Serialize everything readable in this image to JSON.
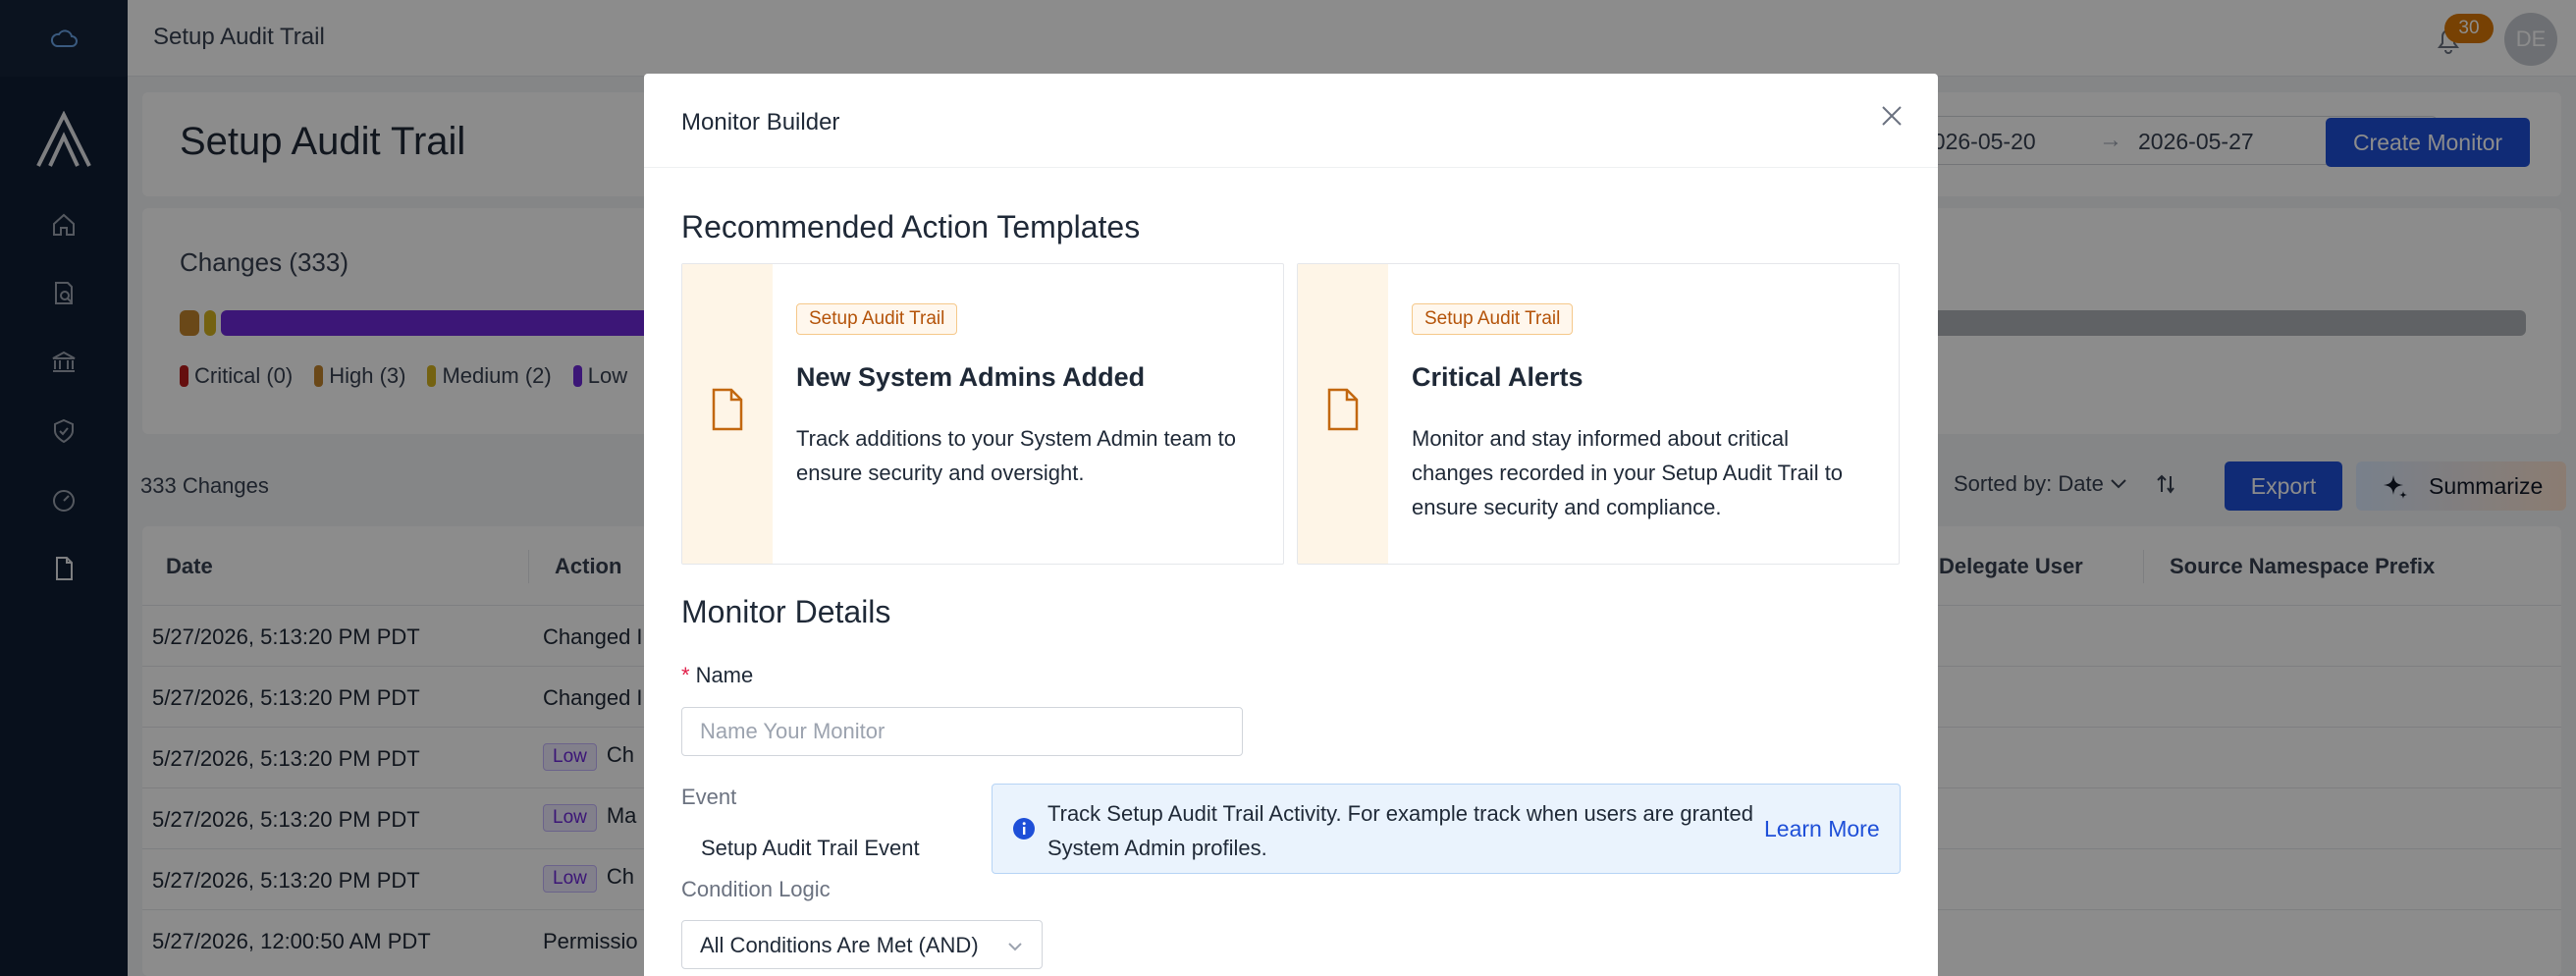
{
  "topbar": {
    "title": "Setup Audit Trail",
    "notification_count": "30",
    "avatar_initials": "DE"
  },
  "rail": {
    "icons": [
      "cloud-icon",
      "app-logo",
      "home-icon",
      "search-document-icon",
      "bank-icon",
      "shield-check-icon",
      "gauge-icon",
      "document-icon"
    ]
  },
  "page": {
    "title": "Setup Audit Trail",
    "date_from": "2026-05-20",
    "date_to": "2026-05-27",
    "date_arrow": "→",
    "create_monitor_label": "Create Monitor",
    "changes_title": "Changes (333)",
    "severity": {
      "critical": {
        "label": "Critical (0)",
        "color": "#b45309"
      },
      "high": {
        "label": "High (3)",
        "color": "#c2832c"
      },
      "medium": {
        "label": "Medium (2)",
        "color": "#d4b21f"
      },
      "low": {
        "label": "Low",
        "color": "#6d28d9"
      }
    },
    "changes_count": "333 Changes",
    "sorted_label": "Sorted by: Date",
    "export_label": "Export",
    "summarize_label": "Summarize",
    "table": {
      "headers": {
        "date": "Date",
        "action": "Action",
        "delegate_user": "Delegate User",
        "source_namespace": "Source Namespace Prefix"
      },
      "rows": [
        {
          "date": "5/27/2026, 5:13:20 PM PDT",
          "badge": "",
          "action": "Changed I"
        },
        {
          "date": "5/27/2026, 5:13:20 PM PDT",
          "badge": "",
          "action": "Changed I"
        },
        {
          "date": "5/27/2026, 5:13:20 PM PDT",
          "badge": "Low",
          "action": "Ch"
        },
        {
          "date": "5/27/2026, 5:13:20 PM PDT",
          "badge": "Low",
          "action": "Ma"
        },
        {
          "date": "5/27/2026, 5:13:20 PM PDT",
          "badge": "Low",
          "action": "Ch"
        },
        {
          "date": "5/27/2026, 12:00:50 AM PDT",
          "badge": "",
          "action": "Permissio"
        }
      ]
    }
  },
  "modal": {
    "title": "Monitor Builder",
    "templates_heading": "Recommended Action Templates",
    "templates": [
      {
        "tag": "Setup Audit Trail",
        "title": "New System Admins Added",
        "description": "Track additions to your System Admin team to ensure security and oversight."
      },
      {
        "tag": "Setup Audit Trail",
        "title": "Critical Alerts",
        "description": "Monitor and stay informed about critical changes recorded in your Setup Audit Trail to ensure security and compliance."
      }
    ],
    "details_heading": "Monitor Details",
    "name_required_mark": "*",
    "name_label": "Name",
    "name_placeholder": "Name Your Monitor",
    "event_label": "Event",
    "event_value": "Setup Audit Trail Event",
    "info_text": "Track Setup Audit Trail Activity. For example track when users are granted System Admin profiles.",
    "learn_more_label": "Learn More",
    "condition_logic_label": "Condition Logic",
    "condition_logic_value": "All Conditions Are Met (AND)"
  }
}
